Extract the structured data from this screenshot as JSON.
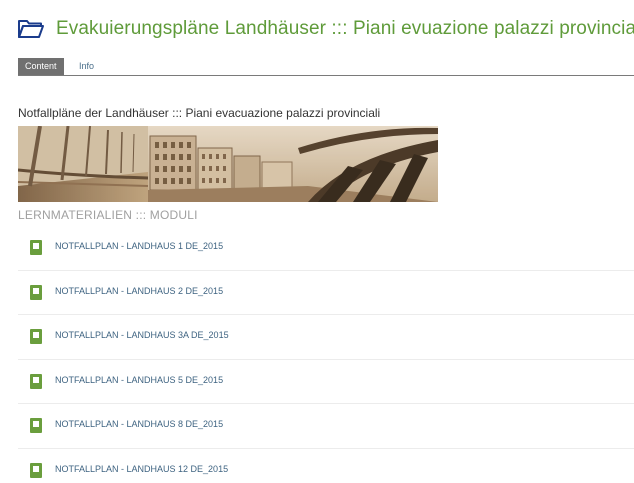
{
  "header": {
    "title": "Evakuierungspläne Landhäuser ::: Piani evuazione palazzi provinciali"
  },
  "tabs": [
    {
      "label": "Content",
      "active": true
    },
    {
      "label": "Info",
      "active": false
    }
  ],
  "subtitle": "Notfallpläne der Landhäuser ::: Piani evacuazione palazzi provinciali",
  "section_heading": "LERNMATERIALIEN ::: MODULI",
  "items": [
    {
      "label": "NOTFALLPLAN - LANDHAUS 1 DE_2015"
    },
    {
      "label": "NOTFALLPLAN - LANDHAUS 2 DE_2015"
    },
    {
      "label": "NOTFALLPLAN - LANDHAUS 3A DE_2015"
    },
    {
      "label": "NOTFALLPLAN - LANDHAUS 5 DE_2015"
    },
    {
      "label": "NOTFALLPLAN - LANDHAUS 8 DE_2015"
    },
    {
      "label": "NOTFALLPLAN - LANDHAUS 12 DE_2015"
    }
  ],
  "colors": {
    "accent_green": "#5f9b3a",
    "link_blue": "#3e6381",
    "tab_active_bg": "#707070"
  }
}
